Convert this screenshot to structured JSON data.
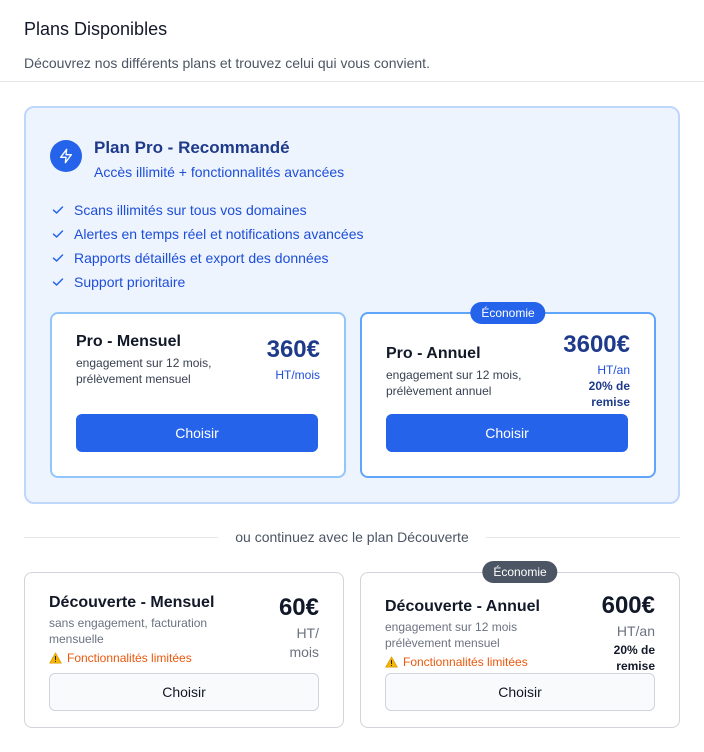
{
  "header": {
    "title": "Plans Disponibles",
    "subtitle": "Découvrez nos différents plans et trouvez celui qui vous convient."
  },
  "pro": {
    "title": "Plan Pro - Recommandé",
    "subtitle": "Accès illimité + fonctionnalités avancées",
    "icon": "bolt-icon",
    "features": [
      "Scans illimités sur tous vos domaines",
      "Alertes en temps réel et notifications avancées",
      "Rapports détaillés et export des données",
      "Support prioritaire"
    ],
    "monthly": {
      "name": "Pro - Mensuel",
      "description": "engagement sur 12 mois, prélèvement mensuel",
      "price": "360€",
      "unit": "HT/mois",
      "button": "Choisir"
    },
    "annual": {
      "badge": "Économie",
      "name": "Pro - Annuel",
      "description": "engagement sur 12 mois, prélèvement annuel",
      "price": "3600€",
      "unit": "HT/an",
      "discount": "20% de remise",
      "button": "Choisir"
    }
  },
  "divider_text": "ou continuez avec le plan Découverte",
  "discovery": {
    "monthly": {
      "name": "Découverte - Mensuel",
      "description": "sans engagement, facturation mensuelle",
      "warning": "Fonctionnalités limitées",
      "price": "60€",
      "unit": "HT/ mois",
      "button": "Choisir"
    },
    "annual": {
      "badge": "Économie",
      "name": "Découverte - Annuel",
      "description": "engagement sur 12 mois prélèvement mensuel",
      "warning": "Fonctionnalités limitées",
      "price": "600€",
      "unit": "HT/an",
      "discount": "20% de remise",
      "button": "Choisir"
    }
  },
  "colors": {
    "accent": "#2563eb",
    "pro_background": "#eef4fe",
    "warning": "#ea580c"
  }
}
